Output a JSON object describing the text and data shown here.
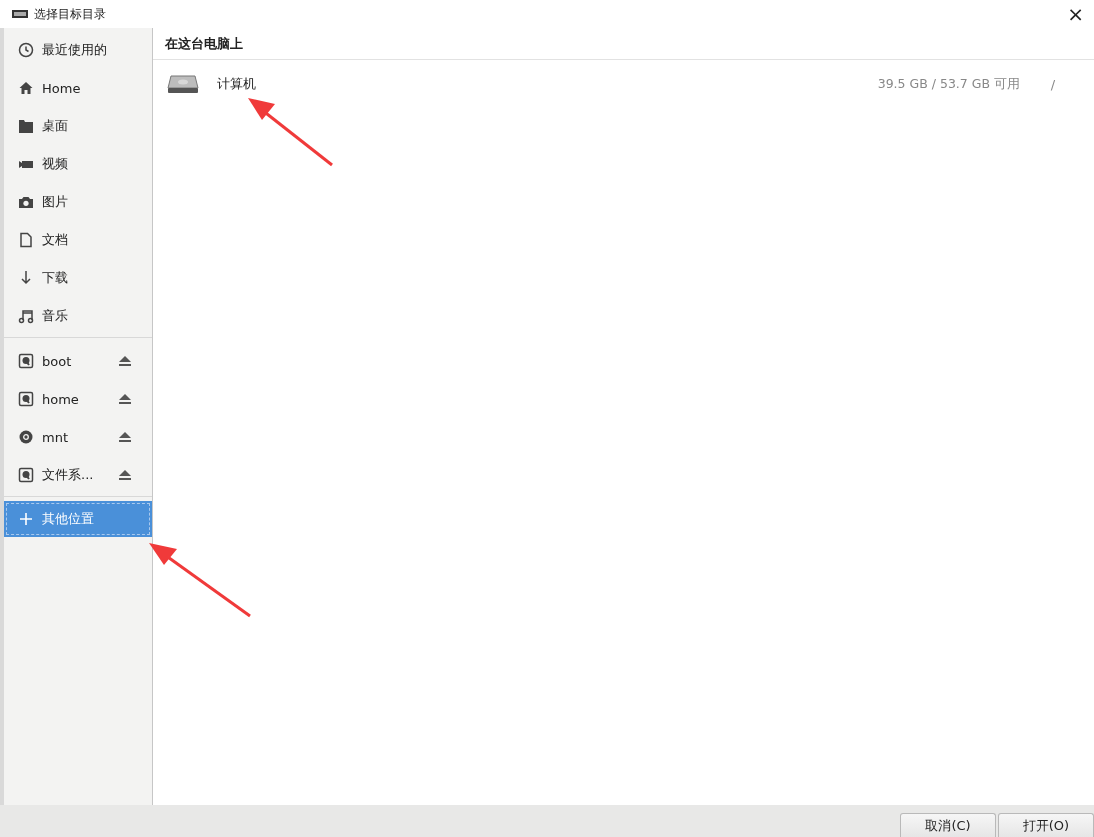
{
  "window": {
    "title": "选择目标目录",
    "close": "×"
  },
  "sidebar": {
    "places": [
      {
        "label": "最近使用的",
        "selected": false
      },
      {
        "label": "Home",
        "selected": false
      },
      {
        "label": "桌面",
        "selected": false
      },
      {
        "label": "视频",
        "selected": false
      },
      {
        "label": "图片",
        "selected": false
      },
      {
        "label": "文档",
        "selected": false
      },
      {
        "label": "下载",
        "selected": false
      },
      {
        "label": "音乐",
        "selected": false
      }
    ],
    "devices": [
      {
        "label": "boot",
        "eject": true,
        "selected": false
      },
      {
        "label": "home",
        "eject": true,
        "selected": false
      },
      {
        "label": "mnt",
        "eject": true,
        "selected": false
      },
      {
        "label": "文件系...",
        "eject": true,
        "selected": false
      }
    ],
    "other": {
      "label": "其他位置",
      "selected": true
    }
  },
  "main": {
    "heading": "在这台电脑上",
    "entries": [
      {
        "name": "计算机",
        "space": "39.5 GB / 53.7 GB 可用",
        "path": "/"
      }
    ]
  },
  "buttons": [
    {
      "label": "取消(C)"
    },
    {
      "label": "打开(O)"
    }
  ]
}
